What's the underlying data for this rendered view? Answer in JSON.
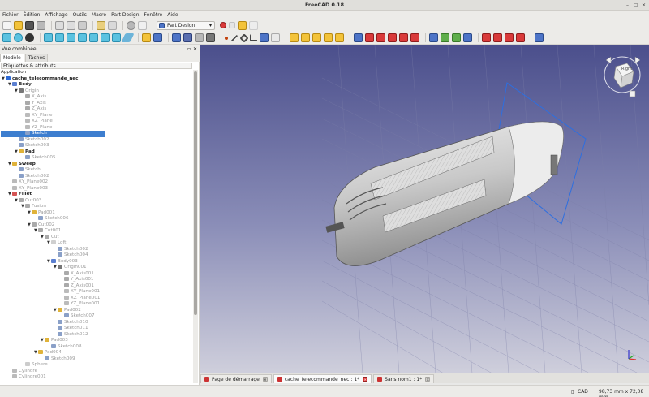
{
  "app": {
    "title": "FreeCAD 0.18"
  },
  "menu": [
    "Fichier",
    "Édition",
    "Affichage",
    "Outils",
    "Macro",
    "Part Design",
    "Fenêtre",
    "Aide"
  ],
  "toolbar": {
    "workbench": "Part Design"
  },
  "panel": {
    "title": "Vue combinée",
    "tabs": [
      "Modèle",
      "Tâches"
    ],
    "header": "Étiquettes & attributs",
    "root": "Application",
    "tree": [
      {
        "label": "cache_telecommande_nec",
        "depth": 0,
        "toggle": "▼",
        "icon": "doc",
        "bold": true
      },
      {
        "label": "Body",
        "depth": 1,
        "toggle": "▼",
        "icon": "body",
        "bold": true
      },
      {
        "label": "Origin",
        "depth": 2,
        "toggle": "▼",
        "icon": "origin",
        "hidden": true
      },
      {
        "label": "X_Axis",
        "depth": 3,
        "toggle": "",
        "icon": "axis",
        "hidden": true
      },
      {
        "label": "Y_Axis",
        "depth": 3,
        "toggle": "",
        "icon": "axis",
        "hidden": true
      },
      {
        "label": "Z_Axis",
        "depth": 3,
        "toggle": "",
        "icon": "axis",
        "hidden": true
      },
      {
        "label": "XY_Plane",
        "depth": 3,
        "toggle": "",
        "icon": "plane",
        "hidden": true
      },
      {
        "label": "XZ_Plane",
        "depth": 3,
        "toggle": "",
        "icon": "plane",
        "hidden": true
      },
      {
        "label": "YZ_Plane",
        "depth": 3,
        "toggle": "",
        "icon": "plane",
        "hidden": true
      },
      {
        "label": "Sketch",
        "depth": 3,
        "toggle": "",
        "icon": "sketch",
        "selected": true
      },
      {
        "label": "Sketch002",
        "depth": 2,
        "toggle": "",
        "icon": "sketch",
        "hidden": true
      },
      {
        "label": "Sketch003",
        "depth": 2,
        "toggle": "",
        "icon": "sketch",
        "hidden": true
      },
      {
        "label": "Pad",
        "depth": 2,
        "toggle": "▼",
        "icon": "pad",
        "bold": true
      },
      {
        "label": "Sketch005",
        "depth": 3,
        "toggle": "",
        "icon": "sketch",
        "hidden": true
      },
      {
        "label": "Sweep",
        "depth": 1,
        "toggle": "▼",
        "icon": "sweep",
        "bold": true
      },
      {
        "label": "Sketch",
        "depth": 2,
        "toggle": "",
        "icon": "sketch",
        "hidden": true
      },
      {
        "label": "Sketch002",
        "depth": 2,
        "toggle": "",
        "icon": "sketch",
        "hidden": true
      },
      {
        "label": "XY_Plane002",
        "depth": 1,
        "toggle": "",
        "icon": "plane",
        "hidden": true
      },
      {
        "label": "XY_Plane003",
        "depth": 1,
        "toggle": "",
        "icon": "plane",
        "hidden": true
      },
      {
        "label": "Fillet",
        "depth": 1,
        "toggle": "▼",
        "icon": "fillet",
        "bold": true
      },
      {
        "label": "Cut003",
        "depth": 2,
        "toggle": "▼",
        "icon": "cut",
        "hidden": true
      },
      {
        "label": "Fusion",
        "depth": 3,
        "toggle": "▼",
        "icon": "fusion",
        "hidden": true
      },
      {
        "label": "Pad001",
        "depth": 4,
        "toggle": "▼",
        "icon": "pad",
        "hidden": true
      },
      {
        "label": "Sketch006",
        "depth": 5,
        "toggle": "",
        "icon": "sketch",
        "hidden": true
      },
      {
        "label": "Cut002",
        "depth": 4,
        "toggle": "▼",
        "icon": "cut",
        "hidden": true
      },
      {
        "label": "Cut001",
        "depth": 5,
        "toggle": "▼",
        "icon": "cut",
        "hidden": true
      },
      {
        "label": "Cut",
        "depth": 6,
        "toggle": "▼",
        "icon": "cut",
        "hidden": true
      },
      {
        "label": "Loft",
        "depth": 7,
        "toggle": "▼",
        "icon": "loft",
        "hidden": true
      },
      {
        "label": "Sketch002",
        "depth": 8,
        "toggle": "",
        "icon": "sketch",
        "hidden": true
      },
      {
        "label": "Sketch004",
        "depth": 8,
        "toggle": "",
        "icon": "sketch",
        "hidden": true
      },
      {
        "label": "Body003",
        "depth": 7,
        "toggle": "▼",
        "icon": "body",
        "hidden": true
      },
      {
        "label": "Origin001",
        "depth": 8,
        "toggle": "▼",
        "icon": "origin",
        "hidden": true
      },
      {
        "label": "X_Axis001",
        "depth": 9,
        "toggle": "",
        "icon": "axis",
        "hidden": true
      },
      {
        "label": "Y_Axis001",
        "depth": 9,
        "toggle": "",
        "icon": "axis",
        "hidden": true
      },
      {
        "label": "Z_Axis001",
        "depth": 9,
        "toggle": "",
        "icon": "axis",
        "hidden": true
      },
      {
        "label": "XY_Plane001",
        "depth": 9,
        "toggle": "",
        "icon": "plane",
        "hidden": true
      },
      {
        "label": "XZ_Plane001",
        "depth": 9,
        "toggle": "",
        "icon": "plane",
        "hidden": true
      },
      {
        "label": "YZ_Plane001",
        "depth": 9,
        "toggle": "",
        "icon": "plane",
        "hidden": true
      },
      {
        "label": "Pad002",
        "depth": 8,
        "toggle": "▼",
        "icon": "pad",
        "hidden": true
      },
      {
        "label": "Sketch007",
        "depth": 9,
        "toggle": "",
        "icon": "sketch",
        "hidden": true
      },
      {
        "label": "Sketch010",
        "depth": 8,
        "toggle": "",
        "icon": "sketch",
        "hidden": true
      },
      {
        "label": "Sketch011",
        "depth": 8,
        "toggle": "",
        "icon": "sketch",
        "hidden": true
      },
      {
        "label": "Sketch012",
        "depth": 8,
        "toggle": "",
        "icon": "sketch",
        "hidden": true
      },
      {
        "label": "Pad003",
        "depth": 6,
        "toggle": "▼",
        "icon": "pad",
        "hidden": true
      },
      {
        "label": "Sketch008",
        "depth": 7,
        "toggle": "",
        "icon": "sketch",
        "hidden": true
      },
      {
        "label": "Pad004",
        "depth": 5,
        "toggle": "▼",
        "icon": "pad",
        "hidden": true
      },
      {
        "label": "Sketch009",
        "depth": 6,
        "toggle": "",
        "icon": "sketch",
        "hidden": true
      },
      {
        "label": "Sphere",
        "depth": 3,
        "toggle": "",
        "icon": "sphere",
        "hidden": true
      },
      {
        "label": "Cylindre",
        "depth": 1,
        "toggle": "",
        "icon": "cylinder",
        "hidden": true
      },
      {
        "label": "Cylindre001",
        "depth": 1,
        "toggle": "",
        "icon": "cylinder",
        "hidden": true
      }
    ]
  },
  "doc_tabs": [
    {
      "label": "Page de démarrage",
      "active": false
    },
    {
      "label": "cache_telecommande_nec : 1*",
      "active": true
    },
    {
      "label": "Sans nom1 : 1*",
      "active": false
    }
  ],
  "navcube": {
    "face": "Right"
  },
  "status": {
    "nav_mode": "CAD",
    "dimensions": "98,73 mm x 72,08 mm"
  },
  "colors": {
    "viewport_top": "#4a4d8a",
    "viewport_bottom": "#c8c8d6",
    "selection": "#3d7ecf"
  }
}
